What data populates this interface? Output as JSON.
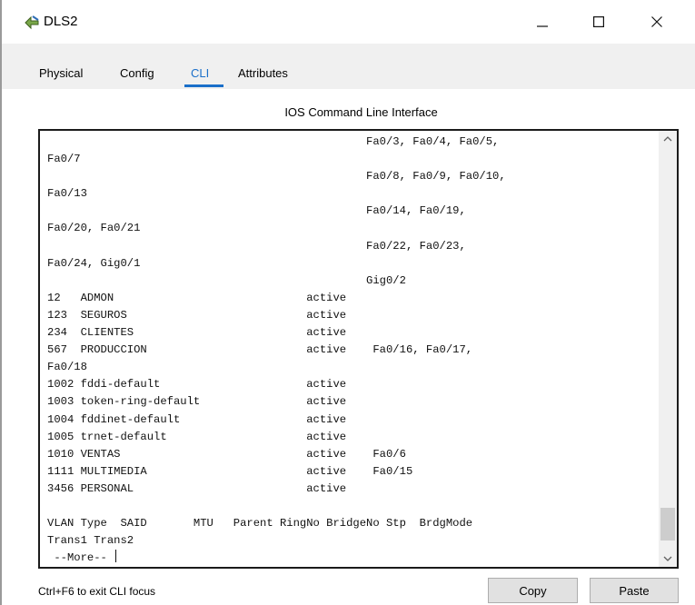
{
  "window": {
    "title": "DLS2",
    "minimize_icon": "minimize-icon",
    "maximize_icon": "maximize-icon",
    "close_icon": "close-icon"
  },
  "tabs": [
    {
      "label": "Physical",
      "active": false
    },
    {
      "label": "Config",
      "active": false
    },
    {
      "label": "CLI",
      "active": true
    },
    {
      "label": "Attributes",
      "active": false
    }
  ],
  "cli": {
    "header": "IOS Command Line Interface",
    "lines": [
      "                                                Fa0/3, Fa0/4, Fa0/5,",
      "Fa0/7",
      "                                                Fa0/8, Fa0/9, Fa0/10,",
      "Fa0/13",
      "                                                Fa0/14, Fa0/19,",
      "Fa0/20, Fa0/21",
      "                                                Fa0/22, Fa0/23,",
      "Fa0/24, Gig0/1",
      "                                                Gig0/2",
      "12   ADMON                             active",
      "123  SEGUROS                           active",
      "234  CLIENTES                          active",
      "567  PRODUCCION                        active    Fa0/16, Fa0/17,",
      "Fa0/18",
      "1002 fddi-default                      active",
      "1003 token-ring-default                active",
      "1004 fddinet-default                   active",
      "1005 trnet-default                     active",
      "1010 VENTAS                            active    Fa0/6",
      "1111 MULTIMEDIA                        active    Fa0/15",
      "3456 PERSONAL                          active",
      "",
      "VLAN Type  SAID       MTU   Parent RingNo BridgeNo Stp  BrdgMode",
      "Trans1 Trans2",
      " --More-- "
    ]
  },
  "footer": {
    "hint": "Ctrl+F6 to exit CLI focus",
    "copy_label": "Copy",
    "paste_label": "Paste"
  },
  "colors": {
    "accent": "#1a6fc9",
    "tab_bar": "#f0f0f0",
    "terminal_border": "#1b1b1b"
  }
}
